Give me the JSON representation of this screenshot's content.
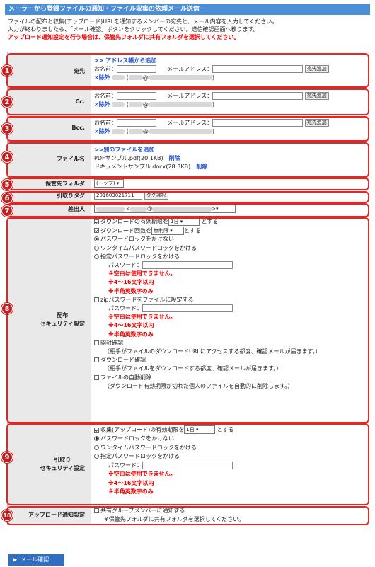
{
  "header": {
    "title": "メーラーから登録ファイルの通知・ファイル収集の依頼メール送信"
  },
  "intro": {
    "line1": "ファイルの配布と収集(アップロード)URLを通知するメンバーの宛先と、メール内容を入力してください。",
    "line2": "入力が終わりましたら、「メール確認」ボタンをクリックしてください。送信確認画面へ移ります。",
    "warning": "アップロード通知設定を行う場合は、保管先フォルダに共有フォルダを選択してください。"
  },
  "markers": [
    "1",
    "2",
    "3",
    "4",
    "5",
    "6",
    "7",
    "8",
    "9",
    "10"
  ],
  "to": {
    "label": "宛先",
    "addressbook_link": ">> アドレス帳から追加",
    "name_label": "お名前：",
    "mail_label": "メールアドレス：",
    "add_button": "宛先追加",
    "remove_label": "×除外",
    "open_paren": "(",
    "at": "@",
    "close_paren": ")"
  },
  "cc": {
    "label": "Cc.",
    "name_label": "お名前：",
    "mail_label": "メールアドレス：",
    "add_button": "宛先追加",
    "remove_label": "×除外",
    "open_paren": "(",
    "at": "@",
    "close_paren": ")"
  },
  "bcc": {
    "label": "Bcc.",
    "name_label": "お名前：",
    "mail_label": "メールアドレス：",
    "add_button": "宛先追加",
    "remove_label": "×除外",
    "open_paren": "(",
    "at": "@",
    "close_paren": ")"
  },
  "files": {
    "label": "ファイル名",
    "add_link": ">>別のファイルを追加",
    "items": [
      {
        "name": "PDFサンプル.pdf(20.1KB)",
        "delete": "削除"
      },
      {
        "name": "ドキュメントサンプル.docx(28.3KB)",
        "delete": "削除"
      }
    ]
  },
  "folder": {
    "label": "保管先フォルダ",
    "value": "(トップ)"
  },
  "tag": {
    "label": "引取りタグ",
    "value": "201603021711",
    "button": "タグ選択"
  },
  "sender": {
    "label": "差出人",
    "lt": "<",
    "at": "@",
    "gt": ">"
  },
  "dist": {
    "label1": "配布",
    "label2": "セキュリティ設定",
    "expiry_pre": "ダウンロードの有効期限を",
    "expiry_value": "1日",
    "expiry_post": "とする",
    "count_pre": "ダウンロード回数を",
    "count_value": "無制限",
    "count_post": "とする",
    "opt_none": "パスワードロックをかけない",
    "opt_onetime": "ワンタイムパスワードロックをかける",
    "opt_fixed": "指定パスワードロックをかける",
    "pw_label": "パスワード：",
    "w1": "※空白は使用できません。",
    "w2": "※4～16文字以内",
    "w3": "※半角英数字のみ",
    "zip_label": "zipパスワードをファイルに設定する",
    "zip_pw_label": "パスワード：",
    "zw1": "※空白は使用できません。",
    "zw2": "※4～16文字以内",
    "zw3": "※半角英数字のみ",
    "open_confirm": "開封確認",
    "open_note": "（相手がファイルのダウンロードURLにアクセスする都度、確認メールが届きます。）",
    "dl_confirm": "ダウンロード確認",
    "dl_note": "（相手がファイルをダウンロードする都度、確認メールが届きます。）",
    "auto_delete": "ファイルの自動削除",
    "auto_note": "（ダウンロード有効期限が切れた個人のファイルを自動的に削除します。）"
  },
  "collect": {
    "label1": "引取り",
    "label2": "セキュリティ設定",
    "expiry_pre": "収集(アップロード)の有効期限を",
    "expiry_value": "1日",
    "expiry_post": "とする",
    "opt_none": "パスワードロックをかけない",
    "opt_onetime": "ワンタイムパスワードロックをかける",
    "opt_fixed": "指定パスワードロックをかける",
    "pw_label": "パスワード：",
    "w1": "※空白は使用できません。",
    "w2": "※4～16文字以内",
    "w3": "※半角英数字のみ"
  },
  "upload": {
    "label": "アップロード通知設定",
    "option": "共有グループメンバーに通知する",
    "note": "※保管先フォルダに共有フォルダを選択してください。"
  },
  "confirm_button": "メール確認",
  "colors": {
    "header": "#4a90d9",
    "marker": "#c61e1e",
    "highlight": "#e22222",
    "button": "#2e6fc1"
  }
}
